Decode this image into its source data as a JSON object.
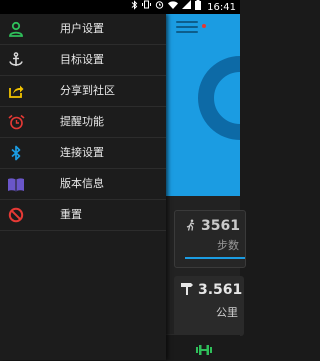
{
  "status_bar": {
    "time": "16:41",
    "icons": [
      "bluetooth-icon",
      "vibrate-icon",
      "alarm-icon",
      "wifi-icon",
      "signal-icon",
      "battery-icon"
    ]
  },
  "drawer": {
    "items": [
      {
        "label": "用户设置",
        "icon": "user-icon",
        "color": "#2fbf5a"
      },
      {
        "label": "目标设置",
        "icon": "anchor-icon",
        "color": "#d9d9d9"
      },
      {
        "label": "分享到社区",
        "icon": "share-icon",
        "color": "#f2c300"
      },
      {
        "label": "提醒功能",
        "icon": "alarm-clock-icon",
        "color": "#e53935"
      },
      {
        "label": "连接设置",
        "icon": "bluetooth-icon",
        "color": "#1b9ce2"
      },
      {
        "label": "版本信息",
        "icon": "book-icon",
        "color": "#6a56c9"
      },
      {
        "label": "重置",
        "icon": "reset-icon",
        "color": "#e53935"
      }
    ]
  },
  "main": {
    "steps_value": "3561",
    "steps_unit": "步数",
    "distance_value": "3.561",
    "distance_unit": "公里"
  },
  "colors": {
    "accent": "#1b9ce2",
    "ring": "#0d6aa6",
    "notification_dot": "#e53935"
  }
}
